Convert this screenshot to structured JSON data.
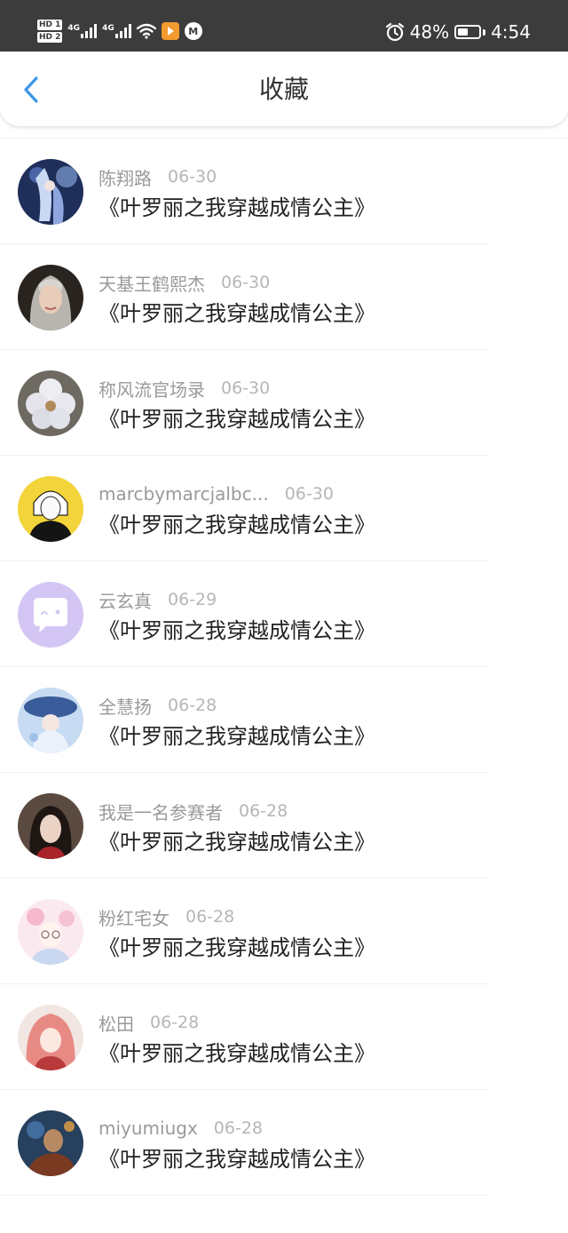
{
  "status_bar": {
    "hd1": "HD 1",
    "hd2": "HD 2",
    "net1": "4G",
    "net2": "4G",
    "battery_text": "48%",
    "battery_level": 0.48,
    "time": "4:54"
  },
  "header": {
    "title": "收藏",
    "back_icon": "chevron-left-icon"
  },
  "items": [
    {
      "author": "陈翔路",
      "date": "06-30",
      "book": "《叶罗丽之我穿越成情公主》"
    },
    {
      "author": "天基王鹤熙杰",
      "date": "06-30",
      "book": "《叶罗丽之我穿越成情公主》"
    },
    {
      "author": "称风流官场录",
      "date": "06-30",
      "book": "《叶罗丽之我穿越成情公主》"
    },
    {
      "author": "marcbymarcjalbc...",
      "date": "06-30",
      "book": "《叶罗丽之我穿越成情公主》"
    },
    {
      "author": "云玄真",
      "date": "06-29",
      "book": "《叶罗丽之我穿越成情公主》"
    },
    {
      "author": "全慧扬",
      "date": "06-28",
      "book": "《叶罗丽之我穿越成情公主》"
    },
    {
      "author": "我是一名参赛者",
      "date": "06-28",
      "book": "《叶罗丽之我穿越成情公主》"
    },
    {
      "author": "粉红宅女",
      "date": "06-28",
      "book": "《叶罗丽之我穿越成情公主》"
    },
    {
      "author": "松田",
      "date": "06-28",
      "book": "《叶罗丽之我穿越成情公主》"
    },
    {
      "author": "miyumiugx",
      "date": "06-28",
      "book": "《叶罗丽之我穿越成情公主》"
    }
  ],
  "colors": {
    "accent": "#3a97e8",
    "status_bar_bg": "#3c3c3c",
    "author_text": "#9a9a9a",
    "title_text": "#222222"
  }
}
